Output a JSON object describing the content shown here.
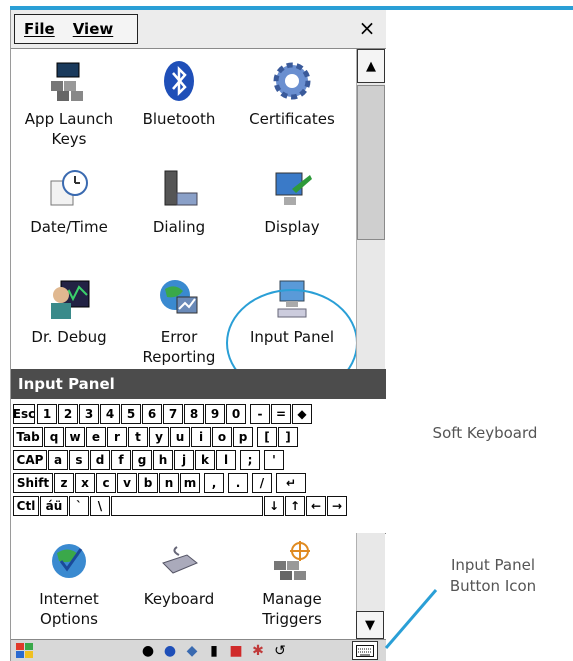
{
  "menu": {
    "file": "File",
    "view": "View",
    "close": "×"
  },
  "tiles_top": [
    {
      "label_1": "App Launch",
      "label_2": "Keys",
      "icon": "keyboard-keys-icon"
    },
    {
      "label_1": "Bluetooth",
      "label_2": "",
      "icon": "bluetooth-icon"
    },
    {
      "label_1": "Certificates",
      "label_2": "",
      "icon": "gear-icon"
    },
    {
      "label_1": "Date/Time",
      "label_2": "",
      "icon": "calendar-clock-icon"
    },
    {
      "label_1": "Dialing",
      "label_2": "",
      "icon": "phone-icon"
    },
    {
      "label_1": "Display",
      "label_2": "",
      "icon": "monitor-icon"
    },
    {
      "label_1": "Dr. Debug",
      "label_2": "",
      "icon": "doctor-icon"
    },
    {
      "label_1": "Error",
      "label_2": "Reporting",
      "icon": "globe-chart-icon"
    },
    {
      "label_1": "Input Panel",
      "label_2": "",
      "icon": "input-panel-icon"
    }
  ],
  "input_panel": {
    "title": "Input Panel",
    "rows": [
      [
        "Esc",
        "1",
        "2",
        "3",
        "4",
        "5",
        "6",
        "7",
        "8",
        "9",
        "0",
        "-",
        "=",
        "◆"
      ],
      [
        "Tab",
        "q",
        "w",
        "e",
        "r",
        "t",
        "y",
        "u",
        "i",
        "o",
        "p",
        "[",
        "]"
      ],
      [
        "CAP",
        "a",
        "s",
        "d",
        "f",
        "g",
        "h",
        "j",
        "k",
        "l",
        ";",
        "'"
      ],
      [
        "Shift",
        "z",
        "x",
        "c",
        "v",
        "b",
        "n",
        "m",
        ",",
        ".",
        "/",
        "↵"
      ],
      [
        "Ctl",
        "áü",
        "`",
        "\\",
        "",
        "↓",
        "↑",
        "←",
        "→"
      ]
    ]
  },
  "tiles_bottom": [
    {
      "label_1": "Internet",
      "label_2": "Options",
      "icon": "globe-check-icon"
    },
    {
      "label_1": "Keyboard",
      "label_2": "",
      "icon": "keyboard-icon"
    },
    {
      "label_1": "Manage",
      "label_2": "Triggers",
      "icon": "trigger-icon"
    }
  ],
  "annotations": {
    "soft_keyboard": "Soft Keyboard",
    "input_panel_button_1": "Input Panel",
    "input_panel_button_2": "Button Icon"
  },
  "colors": {
    "accent": "#2a9fd6",
    "title_bar": "#4c4c4c"
  }
}
